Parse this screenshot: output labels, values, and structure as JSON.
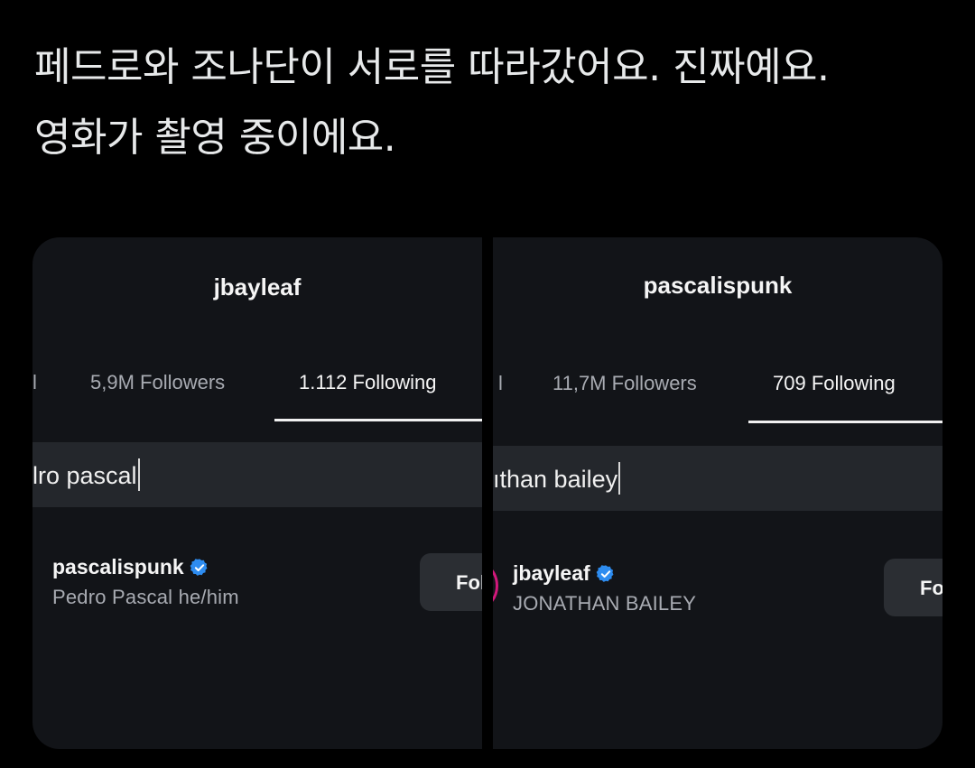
{
  "tweet": {
    "line1": "페드로와 조나단이 서로를 따라갔어요. 진짜예요.",
    "line2": "영화가 촬영 중이에요."
  },
  "left_panel": {
    "profile_username": "jbayleaf",
    "tab_partial": "l",
    "followers_tab": "5,9M Followers",
    "following_tab": "1.112 Following",
    "search_value": "lro pascal",
    "result": {
      "username": "pascalispunk",
      "subtitle": "Pedro Pascal he/him",
      "button_label": "Follow"
    }
  },
  "right_panel": {
    "profile_username": "pascalispunk",
    "tab_partial": "l",
    "followers_tab": "11,7M Followers",
    "following_tab": "709 Following",
    "search_value": "ıthan bailey",
    "result": {
      "username": "jbayleaf",
      "subtitle": "JONATHAN BAILEY",
      "button_label": "Follow"
    }
  },
  "colors": {
    "background": "#000000",
    "panel_bg": "#121418",
    "search_bg": "#24272c",
    "verified_badge": "#2d8cf0",
    "story_ring": "#d3187b"
  }
}
